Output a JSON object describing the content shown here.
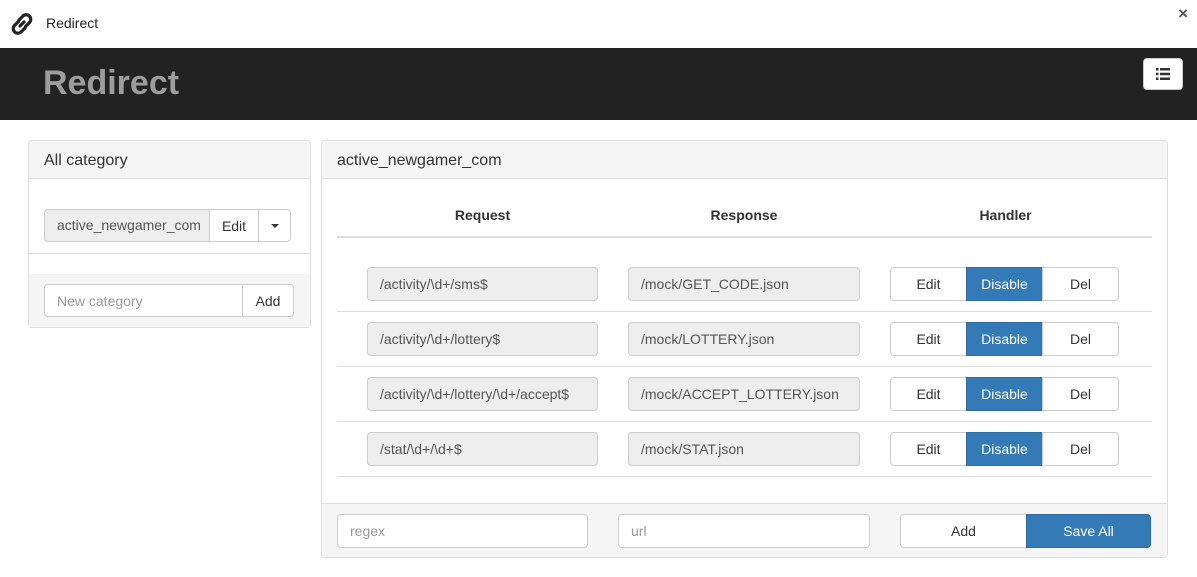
{
  "window": {
    "title": "Redirect",
    "close_glyph": "×"
  },
  "header": {
    "brand": "Redirect",
    "menu_icon": "list-icon"
  },
  "sidebar": {
    "title": "All category",
    "category": {
      "name": "active_newgamer_com",
      "edit_label": "Edit"
    },
    "new_category": {
      "placeholder": "New category",
      "add_label": "Add"
    }
  },
  "main": {
    "title": "active_newgamer_com",
    "columns": {
      "request": "Request",
      "response": "Response",
      "handler": "Handler"
    },
    "rules": [
      {
        "request": "/activity/\\d+/sms$",
        "response": "/mock/GET_CODE.json",
        "edit": "Edit",
        "toggle": "Disable",
        "del": "Del"
      },
      {
        "request": "/activity/\\d+/lottery$",
        "response": "/mock/LOTTERY.json",
        "edit": "Edit",
        "toggle": "Disable",
        "del": "Del"
      },
      {
        "request": "/activity/\\d+/lottery/\\d+/accept$",
        "response": "/mock/ACCEPT_LOTTERY.json",
        "edit": "Edit",
        "toggle": "Disable",
        "del": "Del"
      },
      {
        "request": "/stat/\\d+/\\d+$",
        "response": "/mock/STAT.json",
        "edit": "Edit",
        "toggle": "Disable",
        "del": "Del"
      }
    ],
    "footer": {
      "regex_placeholder": "regex",
      "url_placeholder": "url",
      "add_label": "Add",
      "save_label": "Save All"
    }
  },
  "colors": {
    "header_bg": "#222222",
    "brand": "#9d9d9d",
    "primary": "#337ab7"
  }
}
